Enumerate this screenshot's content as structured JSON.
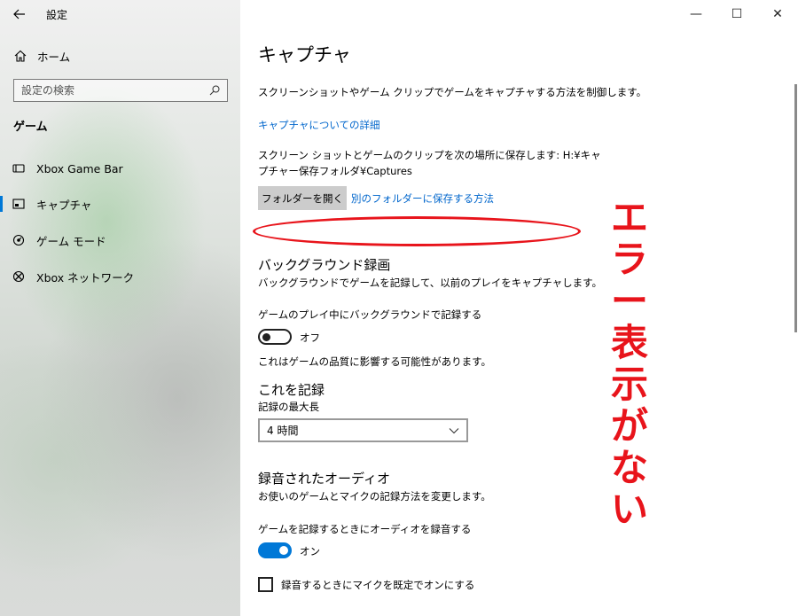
{
  "window": {
    "app_title": "設定",
    "controls": {
      "minimize": "—",
      "maximize": "☐",
      "close": "✕"
    }
  },
  "sidebar": {
    "home_label": "ホーム",
    "search_placeholder": "設定の検索",
    "section_title": "ゲーム",
    "items": [
      {
        "label": "Xbox Game Bar",
        "icon": "xbox-game-bar-icon"
      },
      {
        "label": "キャプチャ",
        "icon": "capture-icon",
        "selected": true
      },
      {
        "label": "ゲーム モード",
        "icon": "game-mode-icon"
      },
      {
        "label": "Xbox ネットワーク",
        "icon": "xbox-icon"
      }
    ]
  },
  "main": {
    "title": "キャプチャ",
    "description": "スクリーンショットやゲーム クリップでゲームをキャプチャする方法を制御します。",
    "details_link": "キャプチャについての詳細",
    "save_path_text": "スクリーン ショットとゲームのクリップを次の場所に保存します: H:¥キャプチャー保存フォルダ¥Captures",
    "open_folder_button": "フォルダーを開く",
    "other_folder_link": "別のフォルダーに保存する方法",
    "background": {
      "heading": "バックグラウンド録画",
      "description": "バックグラウンドでゲームを記録して、以前のプレイをキャプチャします。",
      "toggle_label": "ゲームのプレイ中にバックグラウンドで記録する",
      "toggle_state": "オフ",
      "note": "これはゲームの品質に影響する可能性があります。"
    },
    "record_this": {
      "heading": "これを記録",
      "max_length_label": "記録の最大長",
      "max_length_value": "4 時間"
    },
    "audio": {
      "heading": "録音されたオーディオ",
      "description": "お使いのゲームとマイクの記録方法を変更します。",
      "toggle_label": "ゲームを記録するときにオーディオを録音する",
      "toggle_state": "オン",
      "mic_checkbox_label": "録音するときにマイクを既定でオンにする"
    }
  },
  "annotation": {
    "text": "エラー表示がない",
    "color": "#e8141b"
  },
  "colors": {
    "accent": "#0078d7",
    "link": "#0066cc",
    "annotation_red": "#e8141b"
  }
}
